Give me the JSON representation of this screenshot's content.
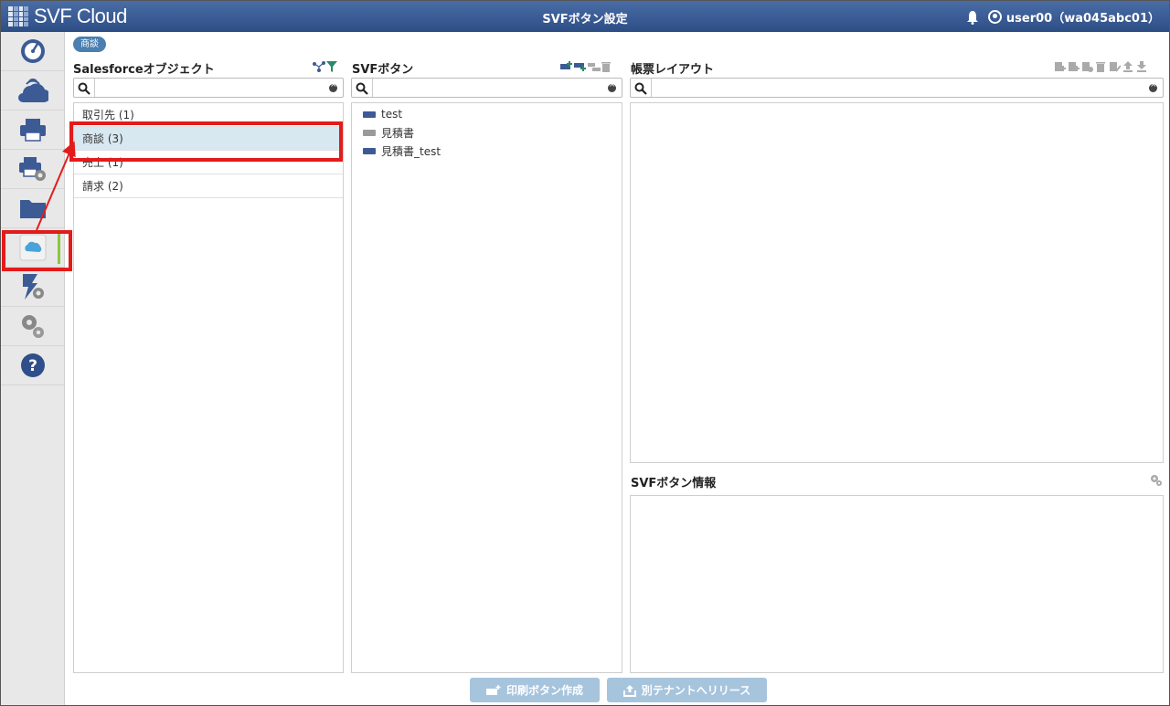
{
  "header": {
    "logo_text": "SVF Cloud",
    "title": "SVFボタン設定",
    "user_label": "user00（wa045abc01）",
    "brand_color": "#3a5c94"
  },
  "sidebar": {
    "items": [
      {
        "icon": "gauge-icon"
      },
      {
        "icon": "cloud-upload-icon"
      },
      {
        "icon": "printer-icon"
      },
      {
        "icon": "printer-settings-icon"
      },
      {
        "icon": "folder-icon"
      },
      {
        "icon": "salesforce-cloud-icon",
        "active": true
      },
      {
        "icon": "flash-settings-icon"
      },
      {
        "icon": "gears-icon"
      },
      {
        "icon": "help-icon"
      }
    ]
  },
  "breadcrumb": "商談",
  "objects_panel": {
    "title": "Salesforceオブジェクト",
    "search_value": "",
    "rows": [
      "取引先 (1)",
      "商談 (3)",
      "売上 (1)",
      "請求 (2)"
    ],
    "selected_index": 1
  },
  "buttons_panel": {
    "title": "SVFボタン",
    "search_value": "",
    "items": [
      {
        "label": "test",
        "color": "#3d5a96"
      },
      {
        "label": "見積書",
        "color": "#9a9a9a"
      },
      {
        "label": "見積書_test",
        "color": "#3d5a96"
      }
    ]
  },
  "layout_panel": {
    "title": "帳票レイアウト",
    "search_value": ""
  },
  "info_panel": {
    "title": "SVFボタン情報"
  },
  "footer": {
    "create_button": "印刷ボタン作成",
    "release_button": "別テナントへリリース"
  },
  "annotation_color": "#e31b1b",
  "selection_color": "#d8e8f1"
}
